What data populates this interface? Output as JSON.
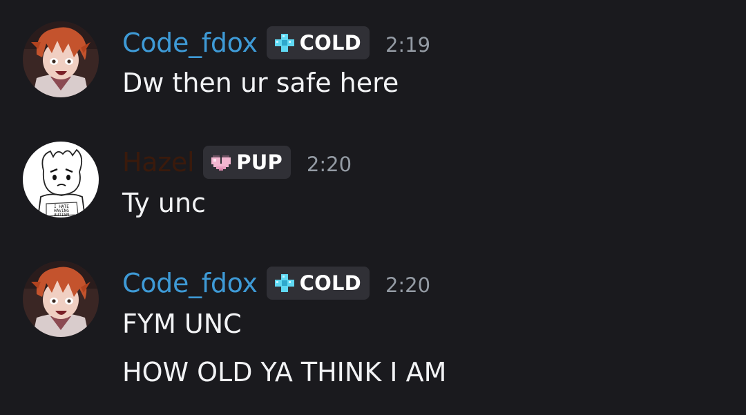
{
  "messages": [
    {
      "author": "Code_fdox",
      "author_color": "#3e9ad6",
      "avatar_icon": "red-haired-anime-avatar-icon",
      "badge": {
        "icon": "cyan-pixel-clover-icon",
        "label": "COLD"
      },
      "time": "2:19",
      "lines": [
        "Dw then ur safe here"
      ]
    },
    {
      "author": "Hazel",
      "author_color": "#3a1a0c",
      "avatar_icon": "sketch-character-avatar-icon",
      "badge": {
        "icon": "pink-pixel-heart-icon",
        "label": "PUP"
      },
      "time": "2:20",
      "lines": [
        "Ty unc"
      ]
    },
    {
      "author": "Code_fdox",
      "author_color": "#3e9ad6",
      "avatar_icon": "red-haired-anime-avatar-icon",
      "badge": {
        "icon": "cyan-pixel-clover-icon",
        "label": "COLD"
      },
      "time": "2:20",
      "lines": [
        "FYM UNC",
        "HOW OLD YA THINK I AM"
      ]
    }
  ],
  "colors": {
    "background": "#1a1a1e",
    "badge_bg": "#303036",
    "text": "#f2f3f5",
    "timestamp": "#949ba4"
  }
}
